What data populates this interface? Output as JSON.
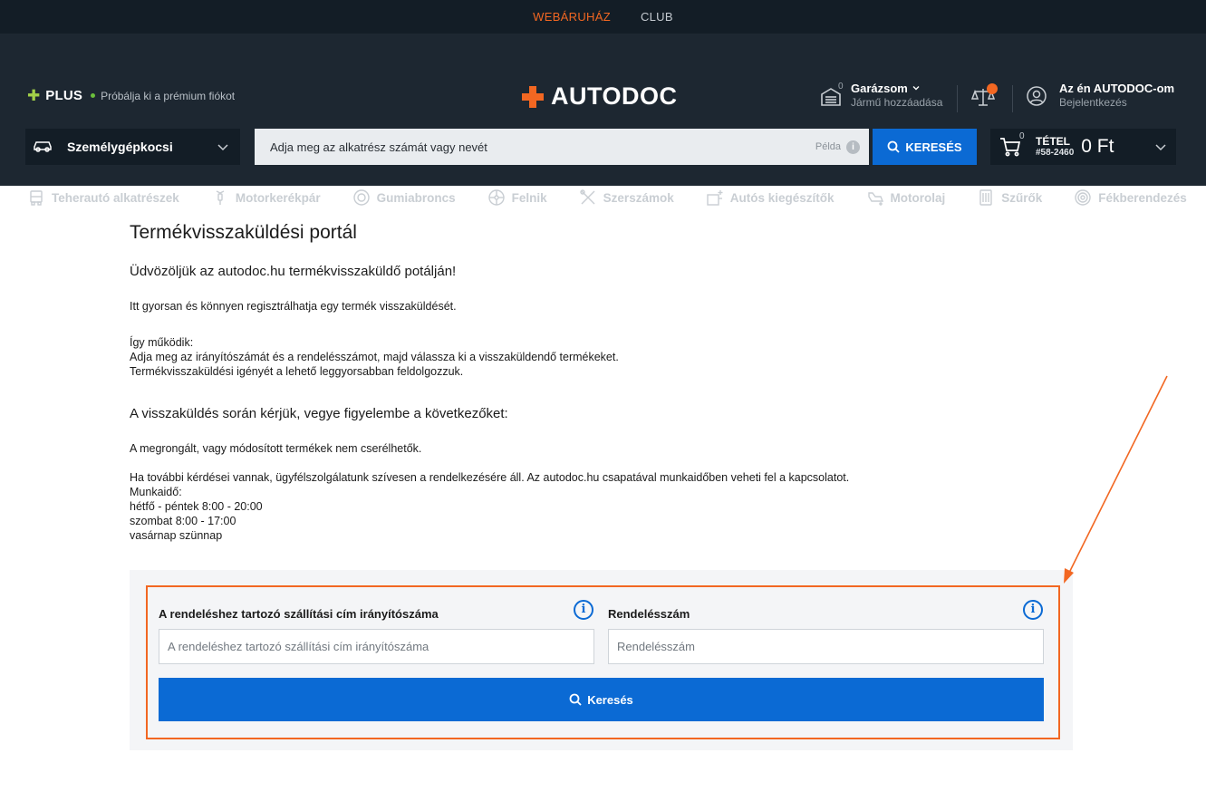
{
  "topbar": {
    "webaruhaz": "WEBÁRUHÁZ",
    "club": "CLUB"
  },
  "header": {
    "plus_label": "PLUS",
    "plus_sub": "Próbálja ki a prémium fiókot",
    "logo": "AUTODOC",
    "garage_count": "0",
    "garage_title": "Garázsom",
    "garage_sub": "Jármű hozzáadása",
    "account_title": "Az én AUTODOC-om",
    "account_sub": "Bejelentkezés"
  },
  "search": {
    "vehicle_type": "Személygépkocsi",
    "placeholder": "Adja meg az alkatrész számát vagy nevét",
    "example": "Példa",
    "button": "KERESÉS"
  },
  "cart": {
    "count": "0",
    "label": "TÉTEL",
    "order_no": "#58-2460",
    "price": "0 Ft"
  },
  "categories": [
    {
      "label": "Teherautó alkatrészek",
      "icon": "truck-icon"
    },
    {
      "label": "Motorkerékpár",
      "icon": "motorcycle-icon"
    },
    {
      "label": "Gumiabroncs",
      "icon": "tire-icon"
    },
    {
      "label": "Felnik",
      "icon": "rim-icon"
    },
    {
      "label": "Szerszámok",
      "icon": "tools-icon"
    },
    {
      "label": "Autós kiegészítők",
      "icon": "accessories-icon"
    },
    {
      "label": "Motorolaj",
      "icon": "oil-icon"
    },
    {
      "label": "Szűrők",
      "icon": "filter-icon"
    },
    {
      "label": "Fékberendezés",
      "icon": "brake-icon"
    }
  ],
  "page": {
    "title": "Termékvisszaküldési portál",
    "welcome": "Üdvözöljük az autodoc.hu termékvisszaküldő potálján!",
    "intro": "Itt gyorsan és könnyen regisztrálhatja egy termék visszaküldését.",
    "how_title": "Így működik:",
    "how_1": "Adja meg az irányítószámát és a rendelésszámot, majd válassza ki a visszaküldendő termékeket.",
    "how_2": "Termékvisszaküldési igényét a lehető leggyorsabban feldolgozzuk.",
    "notice_title": "A visszaküldés során kérjük, vegye figyelembe a következőket:",
    "notice_1": "A megrongált, vagy módosított termékek nem cserélhetők.",
    "contact": "Ha további kérdései vannak, ügyfélszolgálatunk szívesen a rendelkezésére áll. Az autodoc.hu csapatával munkaidőben veheti fel a kapcsolatot.",
    "hours_title": "Munkaidő:",
    "hours_1": "hétfő - péntek 8:00 - 20:00",
    "hours_2": "szombat 8:00 - 17:00",
    "hours_3": "vasárnap szünnap"
  },
  "form": {
    "zip_label": "A rendeléshez tartozó szállítási cím irányítószáma",
    "zip_placeholder": "A rendeléshez tartozó szállítási cím irányítószáma",
    "order_label": "Rendelésszám",
    "order_placeholder": "Rendelésszám",
    "submit": "Keresés"
  },
  "colors": {
    "accent": "#f26722",
    "primary": "#0b6ad4",
    "header_bg": "#1d2731",
    "topbar_bg": "#131d26"
  }
}
